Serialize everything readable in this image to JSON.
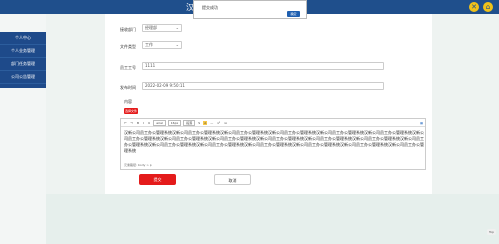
{
  "header": {
    "brand": "汉"
  },
  "sidebar": {
    "items": [
      {
        "label": "个人中心"
      },
      {
        "label": "个人业务管理"
      },
      {
        "label": "部门任务管理"
      },
      {
        "label": "公司公告管理"
      }
    ]
  },
  "form": {
    "dept_label": "接收部门",
    "dept_value": "经理部",
    "type_label": "文件类型",
    "type_value": "工作",
    "title_label": "员工工号",
    "title_value": "1111",
    "time_label": "发布时间",
    "time_value": "2022-02-09 9:50:11",
    "content_label": "内容",
    "upload_label": "选择文件",
    "editor_text": "汉新公司员工办公管理系统汉新公司员工办公管理系统汉新公司员工办公管理系统汉新公司员工办公管理系统汉新公司员工办公管理系统汉新公司员工办公管理系统汉新公司员工办公管理系统汉新公司员工办公管理系统汉新公司员工办公管理系统汉新公司员工办公管理系统汉新公司员工办公管理系统汉新公司员工办公管理系统汉新公司员工办公管理系统汉新公司员工办公管理系统汉新公司员工办公管理系统汉新公司员工办公管理系统汉新公司员工办公管理系统汉新公司员工办公管理系统汉新公司员工办公管理系统",
    "editor_status": "元素路径: body > p",
    "submit_label": "提交",
    "cancel_label": "取消"
  },
  "toolbar": {
    "items": [
      "↶",
      "↷",
      "B",
      "I",
      "U",
      "S",
      "—",
      "x²",
      "x₂"
    ],
    "font_family": "arial",
    "font_size": "16px",
    "heading": "段落",
    "right_label": "▦"
  },
  "dialog": {
    "message": "提交成功",
    "ok_label": "确定"
  },
  "misc": {
    "top_label": "Top"
  }
}
